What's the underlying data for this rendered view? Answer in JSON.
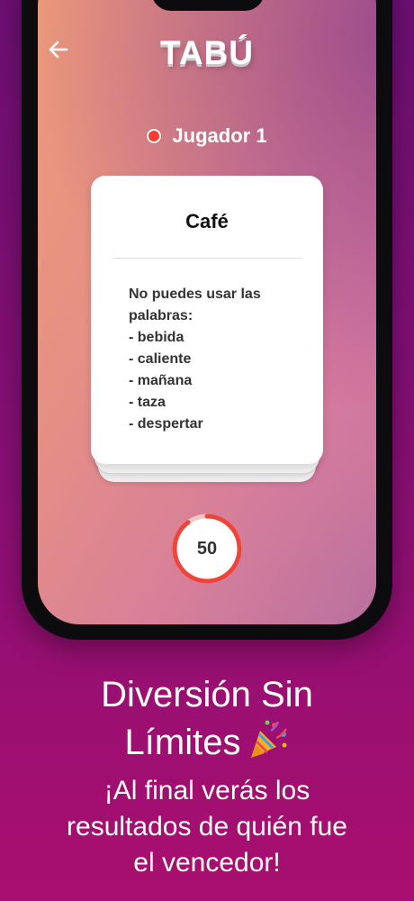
{
  "app": {
    "logo": "TABÚ"
  },
  "player": {
    "name": "Jugador 1",
    "indicator_color": "#ff3b30"
  },
  "card": {
    "word": "Café",
    "instruction_line1": "No puedes usar las",
    "instruction_line2": "palabras:",
    "forbidden_words": [
      "- bebida",
      "- caliente",
      "- mañana",
      "- taza",
      "- despertar"
    ]
  },
  "timer": {
    "value": "50",
    "remaining_fraction": 0.9,
    "color": "#ef4439"
  },
  "promo": {
    "headline_line1": "Diversión Sin",
    "headline_line2": "Límites",
    "headline_emoji": "party-popper-icon",
    "subtitle_line1": "¡Al final verás los",
    "subtitle_line2": "resultados de quién fue",
    "subtitle_line3": "el vencedor!"
  },
  "colors": {
    "background": "#8a0f74",
    "card": "#ffffff",
    "accent": "#ff3b30"
  }
}
